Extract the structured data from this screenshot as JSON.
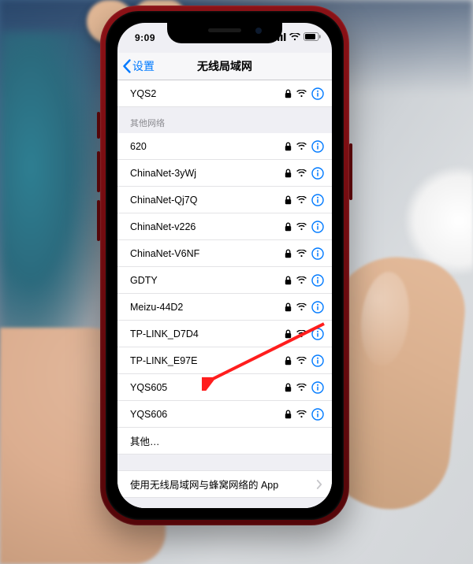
{
  "statusbar": {
    "time": "9:09"
  },
  "nav": {
    "back_label": "设置",
    "title": "无线局域网"
  },
  "my_networks": [
    {
      "name": "YQS2"
    }
  ],
  "other_header": "其他网络",
  "other_networks": [
    {
      "name": "620"
    },
    {
      "name": "ChinaNet-3yWj"
    },
    {
      "name": "ChinaNet-Qj7Q"
    },
    {
      "name": "ChinaNet-v226"
    },
    {
      "name": "ChinaNet-V6NF"
    },
    {
      "name": "GDTY"
    },
    {
      "name": "Meizu-44D2"
    },
    {
      "name": "TP-LINK_D7D4"
    },
    {
      "name": "TP-LINK_E97E"
    },
    {
      "name": "YQS605"
    },
    {
      "name": "YQS606"
    }
  ],
  "other_row_label": "其他…",
  "footer": {
    "label": "使用无线局域网与蜂窝网络的 App"
  },
  "colors": {
    "ios_blue": "#007aff",
    "arrow_red": "#ff1d1d"
  }
}
